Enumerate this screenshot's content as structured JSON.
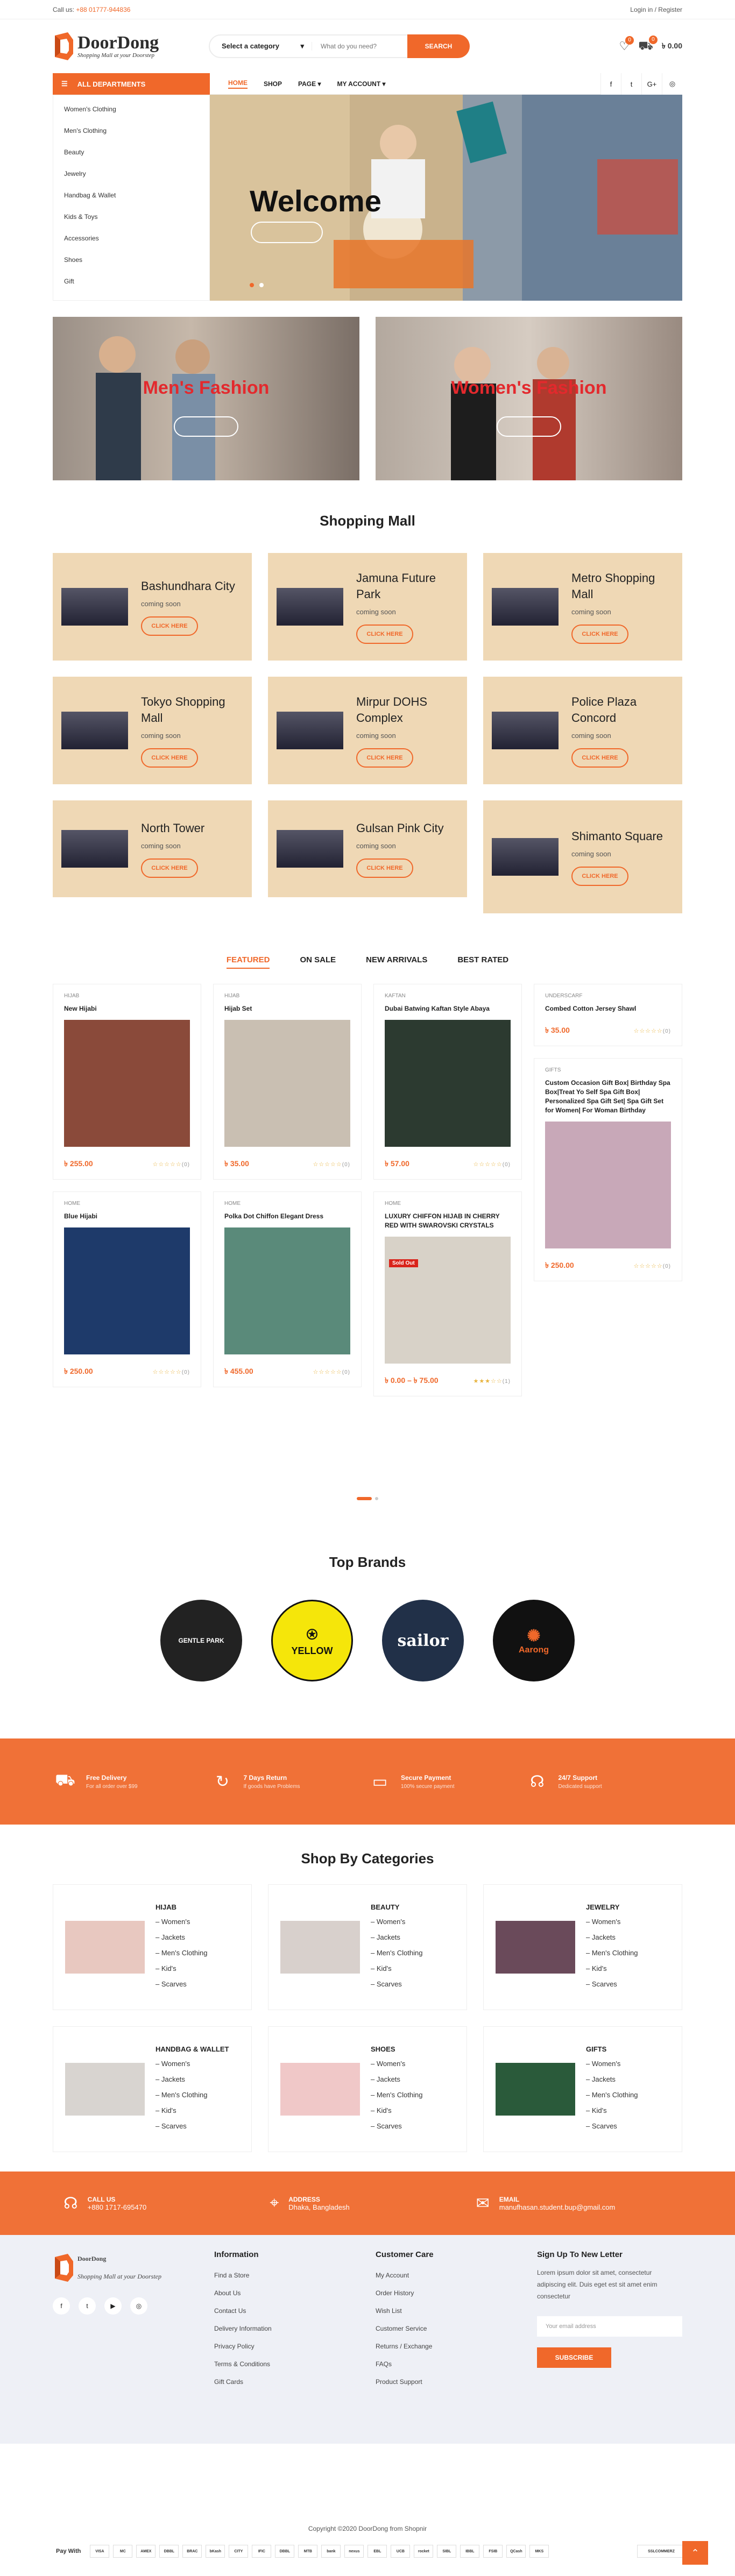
{
  "topbar": {
    "call_label": "Call us:",
    "phone": "+88 01777-944836",
    "account": "Login in / Register"
  },
  "logo": {
    "name": "DoorDong",
    "tagline": "Shopping Mall at your Doorstep"
  },
  "search": {
    "category": "Select a category",
    "placeholder": "What do you need?",
    "button": "SEARCH"
  },
  "header": {
    "wishlist_count": "0",
    "cart_count": "0",
    "cart_total": "৳ 0.00"
  },
  "nav": {
    "all_departments": "ALL DEPARTMENTS",
    "menu": [
      "HOME",
      "SHOP",
      "PAGE ▾",
      "MY ACCOUNT ▾"
    ],
    "social": [
      "f",
      "t",
      "G+",
      "◎"
    ]
  },
  "departments": [
    "Women's Clothing",
    "Men's Clothing",
    "Beauty",
    "Jewelry",
    "Handbag & Wallet",
    "Kids & Toys",
    "Accessories",
    "Shoes",
    "Gift"
  ],
  "hero": {
    "title": "Welcome"
  },
  "banners": [
    {
      "title": "Men's Fashion"
    },
    {
      "title": "Women's Fashion"
    }
  ],
  "mall": {
    "title": "Shopping Mall",
    "button": "CLICK HERE",
    "status": "coming soon",
    "items": [
      "Bashundhara City",
      "Jamuna Future Park",
      "Metro Shopping Mall",
      "Tokyo Shopping Mall",
      "Mirpur DOHS Complex",
      "Police Plaza Concord",
      "North Tower",
      "Gulsan Pink City",
      "Shimanto Square"
    ]
  },
  "product_tabs": [
    "FEATURED",
    "ON SALE",
    "NEW ARRIVALS",
    "BEST RATED"
  ],
  "products": [
    {
      "cat": "HIJAB",
      "name": "New Hijabi",
      "price": "৳ 255.00",
      "reviews": "(0)"
    },
    {
      "cat": "HIJAB",
      "name": "Hijab Set",
      "price": "৳ 35.00",
      "reviews": "(0)"
    },
    {
      "cat": "KAFTAN",
      "name": "Dubai Batwing Kaftan Style Abaya",
      "price": "৳ 57.00",
      "reviews": "(0)"
    },
    {
      "cat": "UNDERSCARF",
      "name": "Combed Cotton Jersey Shawl",
      "price": "৳ 35.00",
      "reviews": "(0)"
    },
    {
      "cat": "HOME",
      "name": "Blue Hijabi",
      "price": "৳ 250.00",
      "reviews": "(0)"
    },
    {
      "cat": "HOME",
      "name": "Polka Dot Chiffon Elegant Dress",
      "price": "৳ 455.00",
      "reviews": "(0)"
    },
    {
      "cat": "HOME",
      "name": "LUXURY CHIFFON HIJAB IN CHERRY RED WITH SWAROVSKI CRYSTALS",
      "price": "৳ 0.00 – ৳ 75.00",
      "reviews": "(1)",
      "badge": "Sold Out"
    },
    {
      "cat": "GIFTS",
      "name": "Custom Occasion Gift Box| Birthday Spa Box|Treat Yo Self Spa Gift Box| Personalized Spa Gift Set| Spa Gift Set for Women| For Woman Birthday",
      "price": "৳ 250.00",
      "reviews": "(0)"
    }
  ],
  "brands": {
    "title": "Top Brands",
    "items": [
      "GENTLE PARK",
      "YELLOW",
      "sailor",
      "Aarong"
    ]
  },
  "features": [
    {
      "title": "Free Delivery",
      "sub": "For all order over $99"
    },
    {
      "title": "7 Days Return",
      "sub": "If goods have Problems"
    },
    {
      "title": "Secure Payment",
      "sub": "100% secure payment"
    },
    {
      "title": "24/7 Support",
      "sub": "Dedicated support"
    }
  ],
  "categories": {
    "title": "Shop By Categories",
    "sub": [
      "– Women's",
      "– Jackets",
      "– Men's Clothing",
      "– Kid's",
      "– Scarves"
    ],
    "items": [
      "HIJAB",
      "BEAUTY",
      "JEWELRY",
      "HANDBAG & WALLET",
      "SHOES",
      "GIFTS"
    ]
  },
  "contact": [
    {
      "title": "CALL US",
      "value": "+880 1717-695470"
    },
    {
      "title": "ADDRESS",
      "value": "Dhaka, Bangladesh"
    },
    {
      "title": "EMAIL",
      "value": "manufhasan.student.bup@gmail.com"
    }
  ],
  "footer": {
    "info_title": "Information",
    "info": [
      "Find a Store",
      "About Us",
      "Contact Us",
      "Delivery Information",
      "Privacy Policy",
      "Terms & Conditions",
      "Gift Cards"
    ],
    "care_title": "Customer Care",
    "care": [
      "My Account",
      "Order History",
      "Wish List",
      "Customer Service",
      "Returns / Exchange",
      "FAQs",
      "Product Support"
    ],
    "news_title": "Sign Up To New Letter",
    "news_text": "Lorem ipsum dolor sit amet, consectetur adipiscing elit. Duis eget est sit amet enim consectetur",
    "email_placeholder": "Your email address",
    "subscribe": "SUBSCRIBE",
    "copyright": "Copyright ©2020 DoorDong from Shopnir",
    "pay_with": "Pay With",
    "payments": [
      "VISA",
      "MC",
      "AMEX",
      "DBBL",
      "BRAC",
      "bKash",
      "CITY",
      "IFIC",
      "DBBL",
      "MTB",
      "bank",
      "nexus",
      "EBL",
      "UCB",
      "rocket",
      "SIBL",
      "IBBL",
      "FSIB",
      "QCash",
      "MKS"
    ],
    "verified": "SSLCOMMERZ"
  }
}
